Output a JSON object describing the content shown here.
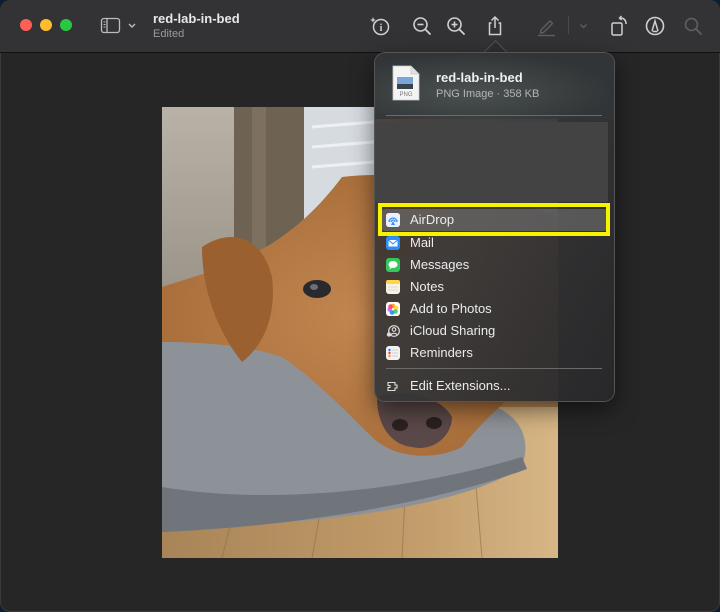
{
  "window": {
    "title": "red-lab-in-bed",
    "subtitle": "Edited"
  },
  "toolbar": {
    "buttons": [
      {
        "name": "info-button",
        "icon": "info-sparkle-icon"
      },
      {
        "name": "zoom-out-button",
        "icon": "zoom-out-icon"
      },
      {
        "name": "zoom-in-button",
        "icon": "zoom-in-icon"
      },
      {
        "name": "share-button",
        "icon": "share-icon"
      },
      {
        "name": "highlight-button",
        "icon": "pencil-icon",
        "disabled": true
      },
      {
        "name": "highlight-dropdown",
        "icon": "chevron-down-icon",
        "disabled": true
      },
      {
        "name": "rotate-button",
        "icon": "rotate-icon"
      },
      {
        "name": "markup-button",
        "icon": "markup-icon"
      },
      {
        "name": "search-button",
        "icon": "search-icon",
        "disabled": true
      }
    ]
  },
  "share_popover": {
    "file_name": "red-lab-in-bed",
    "file_info": "PNG Image · 358 KB",
    "file_icon_label": "PNG",
    "items": [
      {
        "label": "AirDrop",
        "icon": "airdrop-icon",
        "color": "#3b8ff6",
        "highlighted": true
      },
      {
        "label": "Mail",
        "icon": "mail-icon",
        "color": "#2e8ef7"
      },
      {
        "label": "Messages",
        "icon": "messages-icon",
        "color": "#34c759"
      },
      {
        "label": "Notes",
        "icon": "notes-icon",
        "color": "#fdd54a"
      },
      {
        "label": "Add to Photos",
        "icon": "photos-icon",
        "color": "#ff9f0a"
      },
      {
        "label": "iCloud Sharing",
        "icon": "icloud-sharing-icon",
        "color": "#dddddd"
      },
      {
        "label": "Reminders",
        "icon": "reminders-icon",
        "color": "#f2f2f2"
      }
    ],
    "footer_item": {
      "label": "Edit Extensions...",
      "icon": "extensions-icon"
    }
  },
  "colors": {
    "highlight_box": "#f7f300",
    "window_bg": "#262626",
    "toolbar_bg": "#333335"
  }
}
